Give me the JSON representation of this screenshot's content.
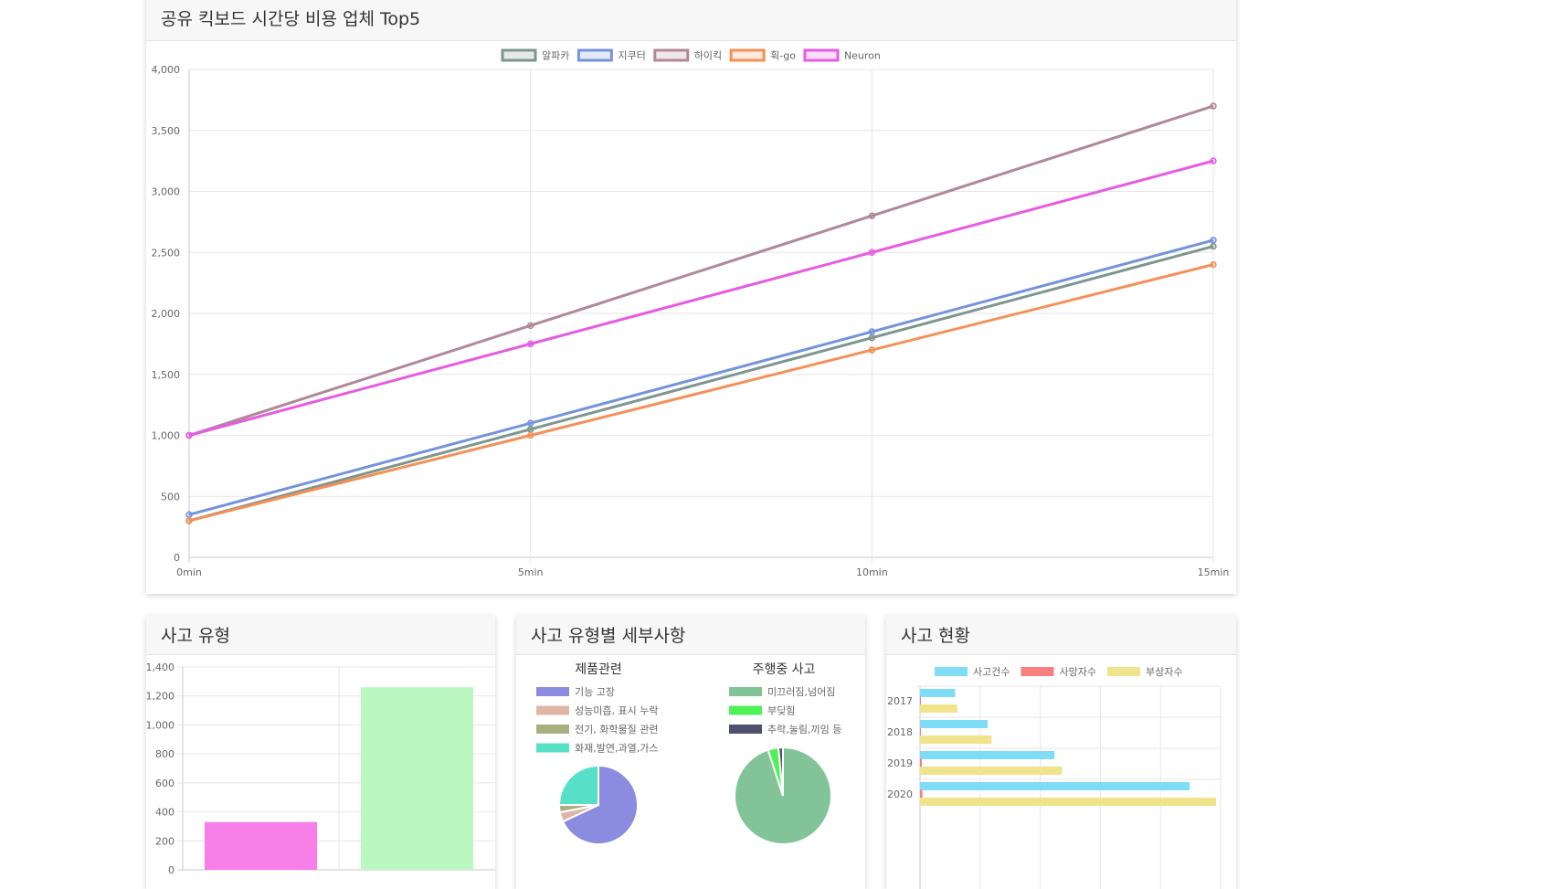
{
  "cards": {
    "top": {
      "title": "공유 킥보드 시간당 비용 업체 Top5"
    },
    "types": {
      "title": "사고 유형"
    },
    "details": {
      "title": "사고 유형별 세부사항"
    },
    "status": {
      "title": "사고 현황"
    }
  },
  "chart_data": [
    {
      "type": "line",
      "title": "",
      "x": [
        "0min",
        "5min",
        "10min",
        "15min"
      ],
      "ylim": [
        0,
        4000
      ],
      "yticks": [
        "0",
        "500",
        "1,000",
        "1,500",
        "2,000",
        "2,500",
        "3,000",
        "3,500",
        "4,000"
      ],
      "grid": true,
      "legend": "top-center",
      "series": [
        {
          "name": "알파카",
          "color": "#7d9690",
          "values": [
            300,
            1050,
            1800,
            2550
          ]
        },
        {
          "name": "지쿠터",
          "color": "#7493dc",
          "values": [
            350,
            1100,
            1850,
            2600
          ]
        },
        {
          "name": "하이킥",
          "color": "#b08898",
          "values": [
            1000,
            1900,
            2800,
            3700
          ]
        },
        {
          "name": "휙-go",
          "color": "#f49055",
          "values": [
            300,
            1000,
            1700,
            2400
          ]
        },
        {
          "name": "Neuron",
          "color": "#e65be3",
          "values": [
            1000,
            1750,
            2500,
            3250
          ]
        }
      ]
    },
    {
      "type": "bar",
      "title": "",
      "categories": [
        "",
        ""
      ],
      "values": [
        330,
        1260
      ],
      "colors": [
        "#f77fe8",
        "#bbf7c1"
      ],
      "ylim": [
        0,
        1400
      ],
      "yticks": [
        "0",
        "200",
        "400",
        "600",
        "800",
        "1,000",
        "1,200",
        "1,400"
      ],
      "grid": true
    },
    {
      "type": "pie",
      "title": "제품관련",
      "labels": [
        "기능 고장",
        "성능미흡, 표시 누락",
        "전기, 화학물질 관련",
        "화재,발연,과열,가스"
      ],
      "colors": [
        "#8b8be0",
        "#dfb6a6",
        "#a8b080",
        "#55e0c7"
      ],
      "values": [
        68,
        4,
        3,
        25
      ],
      "legend": "top"
    },
    {
      "type": "pie",
      "title": "주행중 사고",
      "labels": [
        "미끄러짐,넘어짐",
        "부딪힘",
        "추락,눌림,끼임 등"
      ],
      "colors": [
        "#82c497",
        "#4ff256",
        "#505070"
      ],
      "values": [
        95,
        3.5,
        1.5
      ],
      "legend": "top"
    },
    {
      "type": "bar",
      "orientation": "horizontal",
      "title": "",
      "categories": [
        "2017",
        "2018",
        "2019",
        "2020"
      ],
      "legend": "top-center",
      "series": [
        {
          "name": "사고건수",
          "color": "#7fdcf7",
          "values": [
            117,
            225,
            447,
            897
          ]
        },
        {
          "name": "사망자수",
          "color": "#f77f7f",
          "values": [
            0,
            0,
            4,
            8
          ]
        },
        {
          "name": "부상자수",
          "color": "#efe38c",
          "values": [
            124,
            238,
            473,
            985
          ]
        }
      ],
      "xlim": [
        0,
        1000
      ]
    }
  ]
}
